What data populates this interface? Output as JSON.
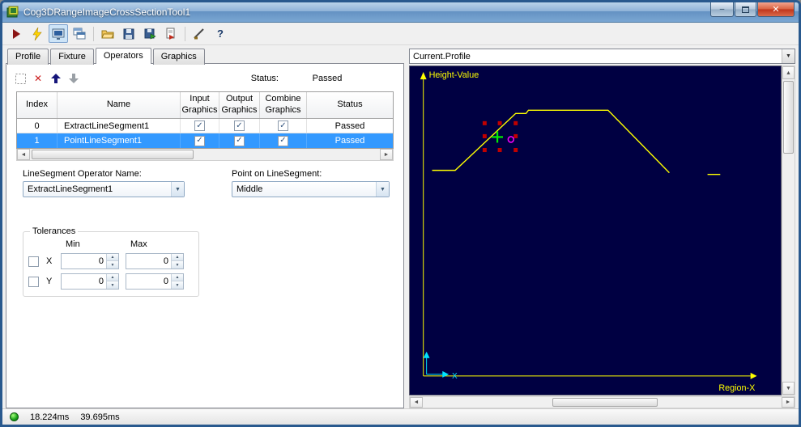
{
  "window": {
    "title": "Cog3DRangeImageCrossSectionTool1"
  },
  "icons": {
    "check": "✓",
    "combo_arrow": "▼",
    "up_small": "▲",
    "down_small": "▼",
    "left_small": "◄",
    "right_small": "►",
    "minimize": "–",
    "close": "✕",
    "delete": "✕",
    "help": "?"
  },
  "toolbar": {
    "icon_names": [
      "run",
      "electric-run",
      "live-display-toggle",
      "result-window",
      "open-file",
      "save-file",
      "save-results",
      "import",
      "measure",
      "help"
    ]
  },
  "tabs": [
    {
      "label": "Profile"
    },
    {
      "label": "Fixture"
    },
    {
      "label": "Operators"
    },
    {
      "label": "Graphics"
    }
  ],
  "operators_panel": {
    "status_label": "Status:",
    "status_value": "Passed",
    "table": {
      "columns": [
        "Index",
        "Name",
        "Input\nGraphics",
        "Output\nGraphics",
        "Combine\nGraphics",
        "Status"
      ],
      "rows": [
        {
          "index": "0",
          "name": "ExtractLineSegment1",
          "input": true,
          "output": true,
          "combine": true,
          "status": "Passed",
          "selected": false
        },
        {
          "index": "1",
          "name": "PointLineSegment1",
          "input": true,
          "output": true,
          "combine": true,
          "status": "Passed",
          "selected": true
        }
      ]
    },
    "operator_name_label": "LineSegment Operator Name:",
    "operator_name_value": "ExtractLineSegment1",
    "point_label": "Point on LineSegment:",
    "point_value": "Middle",
    "tolerances": {
      "legend": "Tolerances",
      "min_header": "Min",
      "max_header": "Max",
      "rows": [
        {
          "label": "X",
          "checked": false,
          "min": "0",
          "max": "0"
        },
        {
          "label": "Y",
          "checked": false,
          "min": "0",
          "max": "0"
        }
      ]
    }
  },
  "graph_panel": {
    "selector_value": "Current.Profile",
    "y_axis_label": "Height-Value",
    "x_axis_label": "Region-X",
    "mini_axis_label": "X",
    "background": "#000042",
    "axis_color": "#ffff00",
    "mini_axis_color": "#00e5ff",
    "profile_color": "#ffff00",
    "handle_color": "#c00000",
    "cross_color": "#00ee00",
    "circle_color": "#ff00ff",
    "chart_data": {
      "type": "line",
      "profile_segments": [
        [
          [
            28,
            128
          ],
          [
            57,
            128
          ],
          [
            133,
            58
          ],
          [
            146,
            58
          ],
          [
            149,
            54
          ],
          [
            249,
            54
          ],
          [
            253,
            58
          ],
          [
            326,
            131
          ]
        ],
        [
          [
            374,
            133
          ],
          [
            390,
            133
          ]
        ]
      ],
      "selection_handles": [
        [
          94,
          70
        ],
        [
          113,
          70
        ],
        [
          133,
          70
        ],
        [
          94,
          86
        ],
        [
          133,
          86
        ],
        [
          94,
          103
        ],
        [
          113,
          103
        ],
        [
          133,
          103
        ]
      ],
      "cross_marker": [
        110,
        87
      ],
      "circle_marker": [
        127,
        90
      ]
    }
  },
  "status_bar": {
    "time1": "18.224ms",
    "time2": "39.695ms"
  }
}
